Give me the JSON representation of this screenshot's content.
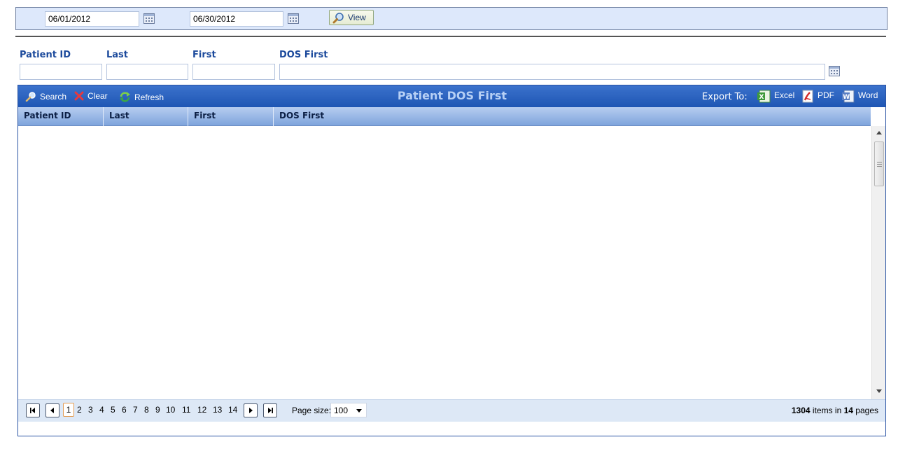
{
  "date_range": {
    "start": "06/01/2012",
    "end": "06/30/2012",
    "view_label": "View"
  },
  "filters": [
    {
      "label": "Patient ID",
      "value": ""
    },
    {
      "label": "Last",
      "value": ""
    },
    {
      "label": "First",
      "value": ""
    },
    {
      "label": "DOS First",
      "value": ""
    }
  ],
  "grid": {
    "title": "Patient DOS First",
    "toolbar": {
      "search_label": "Search",
      "clear_label": "Clear",
      "refresh_label": "Refresh"
    },
    "export": {
      "label": "Export To:",
      "excel_label": "Excel",
      "pdf_label": "PDF",
      "word_label": "Word"
    },
    "columns": [
      "Patient ID",
      "Last",
      "First",
      "DOS First"
    ],
    "rows": []
  },
  "pager": {
    "current_page": "1",
    "pages": [
      "2",
      "3",
      "4",
      "5",
      "6",
      "7",
      "8",
      "9",
      "10",
      "11",
      "12",
      "13",
      "14"
    ],
    "page_size_label": "Page size:",
    "page_size": "100",
    "total_items": "1304",
    "items_in_text": "items in",
    "total_pages": "14",
    "pages_text": "pages"
  },
  "colors": {
    "header_blue": "#1f56b4",
    "label_blue": "#1c4a9c",
    "date_bar_bg": "#dde8fb"
  }
}
